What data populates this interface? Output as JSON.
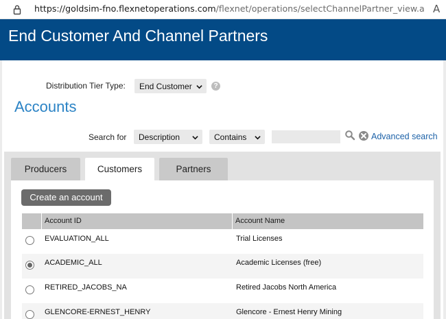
{
  "browser": {
    "url_host": "https://goldsim-fno.flexnetoperations.com",
    "url_path": "/flexnet/operations/selectChannelPartner_view.a...",
    "reader_icon": "A"
  },
  "header": {
    "title": "End Customer And Channel Partners"
  },
  "distribution": {
    "label": "Distribution Tier Type:",
    "selected": "End Customer",
    "help_glyph": "?"
  },
  "accounts": {
    "title": "Accounts"
  },
  "search": {
    "label": "Search for",
    "field_selected": "Description",
    "operator_selected": "Contains",
    "value": "",
    "advanced_label": "Advanced search"
  },
  "tabs": [
    {
      "label": "Producers"
    },
    {
      "label": "Customers"
    },
    {
      "label": "Partners"
    }
  ],
  "create_button": "Create an account",
  "table": {
    "columns": [
      "Account ID",
      "Account Name"
    ],
    "rows": [
      {
        "id": "EVALUATION_ALL",
        "name": "Trial Licenses",
        "selected": false
      },
      {
        "id": "ACADEMIC_ALL",
        "name": "Academic Licenses (free)",
        "selected": true
      },
      {
        "id": "RETIRED_JACOBS_NA",
        "name": "Retired Jacobs North America",
        "selected": false
      },
      {
        "id": "GLENCORE-ERNEST_HENRY",
        "name": "Glencore - Ernest Henry Mining",
        "selected": false
      }
    ]
  },
  "colors": {
    "header_bg": "#034a86",
    "accent_link": "#1d62a8",
    "title_blue": "#2b83c5"
  }
}
